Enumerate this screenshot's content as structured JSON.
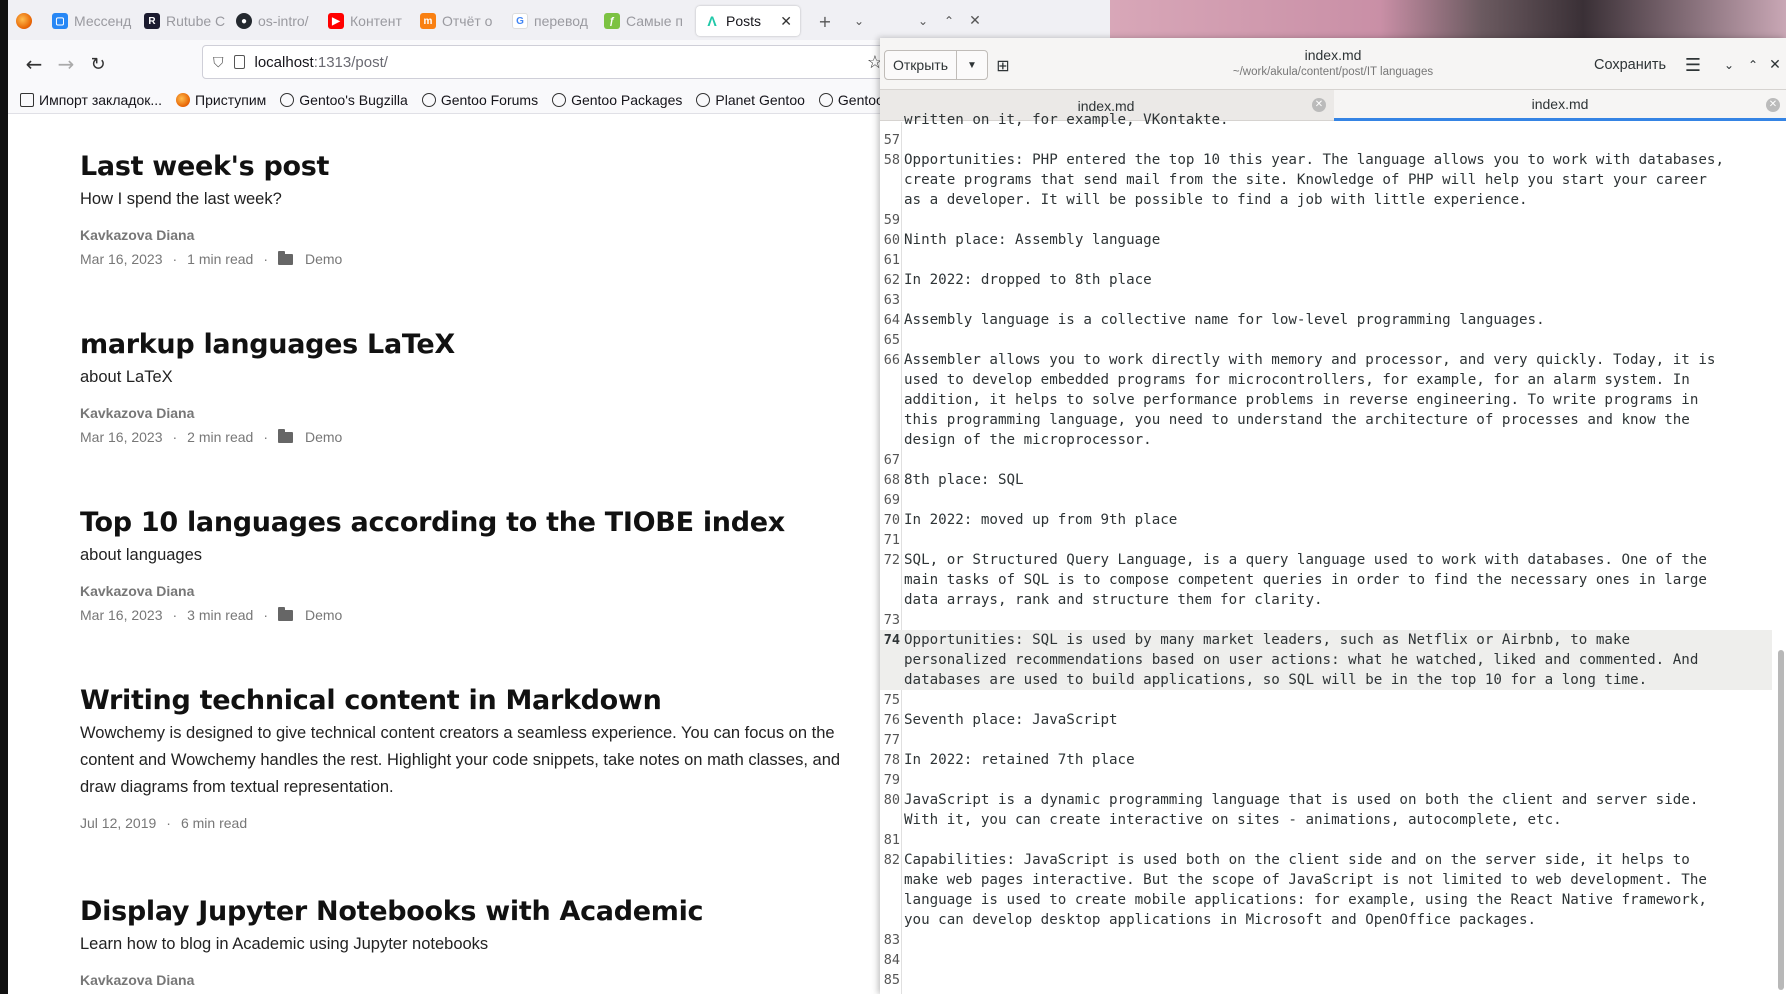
{
  "browser": {
    "tabs": [
      {
        "label": "",
        "icon": "firefox-icon"
      },
      {
        "label": "Мессенд",
        "icon": "messenger-icon"
      },
      {
        "label": "Rutube С",
        "icon": "rutube-icon"
      },
      {
        "label": "os-intro/",
        "icon": "github-icon"
      },
      {
        "label": "Контент",
        "icon": "youtube-icon"
      },
      {
        "label": "Отчёт о",
        "icon": "moodle-icon"
      },
      {
        "label": "перевод",
        "icon": "google-icon"
      },
      {
        "label": "Самые п",
        "icon": "site-icon"
      },
      {
        "label": "Posts",
        "icon": "academic-icon"
      }
    ],
    "url_host": "localhost",
    "url_rest": ":1313/post/",
    "bookmarks": [
      {
        "label": "Импорт закладок...",
        "icon": "import-icon"
      },
      {
        "label": "Приступим",
        "icon": "firefox-icon"
      },
      {
        "label": "Gentoo's Bugzilla",
        "icon": "globe-icon"
      },
      {
        "label": "Gentoo Forums",
        "icon": "globe-icon"
      },
      {
        "label": "Gentoo Packages",
        "icon": "globe-icon"
      },
      {
        "label": "Planet Gentoo",
        "icon": "globe-icon"
      },
      {
        "label": "Gentoo",
        "icon": "globe-icon"
      }
    ],
    "posts": [
      {
        "title": "Last week's post",
        "summary": "How I spend the last week?",
        "author": "Kavkazova Diana",
        "date": "Mar 16, 2023",
        "read": "1 min read",
        "category": "Demo"
      },
      {
        "title": "markup languages LaTeX",
        "summary": "about LaTeX",
        "author": "Kavkazova Diana",
        "date": "Mar 16, 2023",
        "read": "2 min read",
        "category": "Demo"
      },
      {
        "title": "Top 10 languages according to the TIOBE index",
        "summary": "about languages",
        "author": "Kavkazova Diana",
        "date": "Mar 16, 2023",
        "read": "3 min read",
        "category": "Demo"
      },
      {
        "title": "Writing technical content in Markdown",
        "summary": "Wowchemy is designed to give technical content creators a seamless experience. You can focus on the content and Wowchemy handles the rest. Highlight your code snippets, take notes on math classes, and draw diagrams from textual representation.",
        "author": "",
        "date": "Jul 12, 2019",
        "read": "6 min read",
        "category": ""
      },
      {
        "title": "Display Jupyter Notebooks with Academic",
        "summary": "Learn how to blog in Academic using Jupyter notebooks",
        "author": "Kavkazova Diana",
        "date": "",
        "read": "",
        "category": ""
      }
    ]
  },
  "editor": {
    "open_label": "Открыть",
    "title": "index.md",
    "subtitle": "~/work/akula/content/post/IT languages",
    "save_label": "Сохранить",
    "tabs": [
      {
        "label": "index.md"
      },
      {
        "label": "index.md"
      }
    ],
    "lines": [
      {
        "n": "",
        "text": "written on it, for example, VKontakte."
      },
      {
        "n": "57",
        "text": ""
      },
      {
        "n": "58",
        "text": "Opportunities: PHP entered the top 10 this year. The language allows you to work with databases,\ncreate programs that send mail from the site. Knowledge of PHP will help you start your career\nas a developer. It will be possible to find a job with little experience."
      },
      {
        "n": "59",
        "text": ""
      },
      {
        "n": "60",
        "text": "Ninth place: Assembly language"
      },
      {
        "n": "61",
        "text": ""
      },
      {
        "n": "62",
        "text": "In 2022: dropped to 8th place"
      },
      {
        "n": "63",
        "text": ""
      },
      {
        "n": "64",
        "text": "Assembly language is a collective name for low-level programming languages."
      },
      {
        "n": "65",
        "text": ""
      },
      {
        "n": "66",
        "text": "Assembler allows you to work directly with memory and processor, and very quickly. Today, it is\nused to develop embedded programs for microcontrollers, for example, for an alarm system. In\naddition, it helps to solve performance problems in reverse engineering. To write programs in\nthis programming language, you need to understand the architecture of processes and know the\ndesign of the microprocessor."
      },
      {
        "n": "67",
        "text": ""
      },
      {
        "n": "68",
        "text": "8th place: SQL"
      },
      {
        "n": "69",
        "text": ""
      },
      {
        "n": "70",
        "text": "In 2022: moved up from 9th place"
      },
      {
        "n": "71",
        "text": ""
      },
      {
        "n": "72",
        "text": "SQL, or Structured Query Language, is a query language used to work with databases. One of the\nmain tasks of SQL is to compose competent queries in order to find the necessary ones in large\ndata arrays, rank and structure them for clarity."
      },
      {
        "n": "73",
        "text": ""
      },
      {
        "n": "74",
        "text": "Opportunities: SQL is used by many market leaders, such as Netflix or Airbnb, to make\npersonalized recommendations based on user actions: what he watched, liked and commented. And\ndatabases are used to build applications, so SQL will be in the top 10 for a long time.",
        "current": true
      },
      {
        "n": "75",
        "text": ""
      },
      {
        "n": "76",
        "text": "Seventh place: JavaScript"
      },
      {
        "n": "77",
        "text": ""
      },
      {
        "n": "78",
        "text": "In 2022: retained 7th place"
      },
      {
        "n": "79",
        "text": ""
      },
      {
        "n": "80",
        "text": "JavaScript is a dynamic programming language that is used on both the client and server side.\nWith it, you can create interactive on sites - animations, autocomplete, etc."
      },
      {
        "n": "81",
        "text": ""
      },
      {
        "n": "82",
        "text": "Capabilities: JavaScript is used both on the client side and on the server side, it helps to\nmake web pages interactive. But the scope of JavaScript is not limited to web development. The\nlanguage is used to create mobile applications: for example, using the React Native framework,\nyou can develop desktop applications in Microsoft and OpenOffice packages."
      },
      {
        "n": "83",
        "text": ""
      },
      {
        "n": "84",
        "text": ""
      },
      {
        "n": "85",
        "text": ""
      }
    ]
  }
}
